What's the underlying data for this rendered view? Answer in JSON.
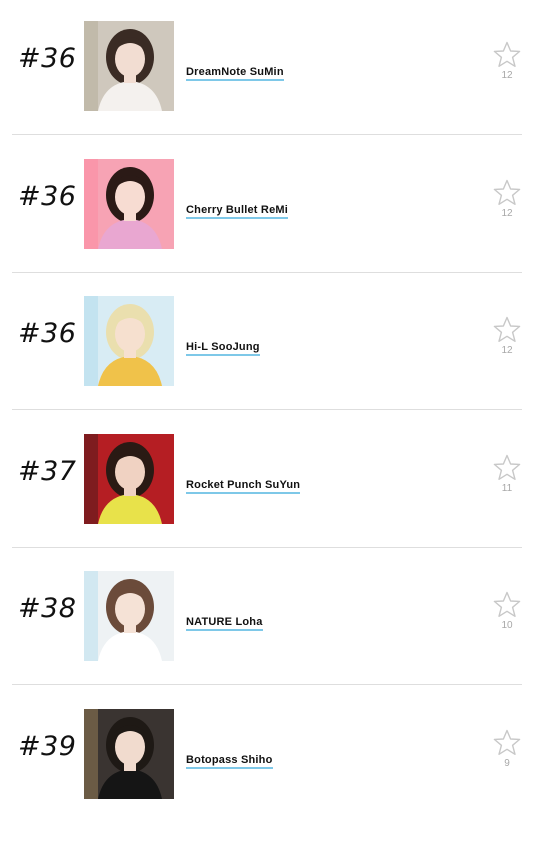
{
  "ranking": [
    {
      "rank": "#36",
      "name": "DreamNote SuMin",
      "votes": "12",
      "photo": {
        "bg": "#cfc8bd",
        "hair": "#3a2b24",
        "skin": "#f2ddd2",
        "cloth": "#f4f1ee",
        "accent": "#a6a086"
      }
    },
    {
      "rank": "#36",
      "name": "Cherry Bullet ReMi",
      "votes": "12",
      "photo": {
        "bg": "#f7a3b4",
        "hair": "#2b1a16",
        "skin": "#f7dcd2",
        "cloth": "#e9a7d1",
        "accent": "#ff7d98"
      }
    },
    {
      "rank": "#36",
      "name": "Hi-L SooJung",
      "votes": "12",
      "photo": {
        "bg": "#d8ecf4",
        "hair": "#eadfae",
        "skin": "#f6e0cf",
        "cloth": "#f0c24a",
        "accent": "#9fd3e9"
      }
    },
    {
      "rank": "#37",
      "name": "Rocket Punch SuYun",
      "votes": "11",
      "photo": {
        "bg": "#b51e23",
        "hair": "#2a1a14",
        "skin": "#f0d2c2",
        "cloth": "#e8e24a",
        "accent": "#1b1b1b"
      }
    },
    {
      "rank": "#38",
      "name": "NATURE Loha",
      "votes": "10",
      "photo": {
        "bg": "#eef2f4",
        "hair": "#6b4b3a",
        "skin": "#f5e2d6",
        "cloth": "#ffffff",
        "accent": "#9fd8ea"
      }
    },
    {
      "rank": "#39",
      "name": "Botopass Shiho",
      "votes": "9",
      "photo": {
        "bg": "#3a3431",
        "hair": "#1e1915",
        "skin": "#f1dbce",
        "cloth": "#151515",
        "accent": "#c9a56c"
      }
    }
  ],
  "icons": {
    "vote": "star-outline-icon"
  },
  "colors": {
    "divider": "#dedede",
    "name_underline": "#7ec8e8",
    "vote_count": "#a8a8a8",
    "star_stroke": "#c8c8c8"
  }
}
